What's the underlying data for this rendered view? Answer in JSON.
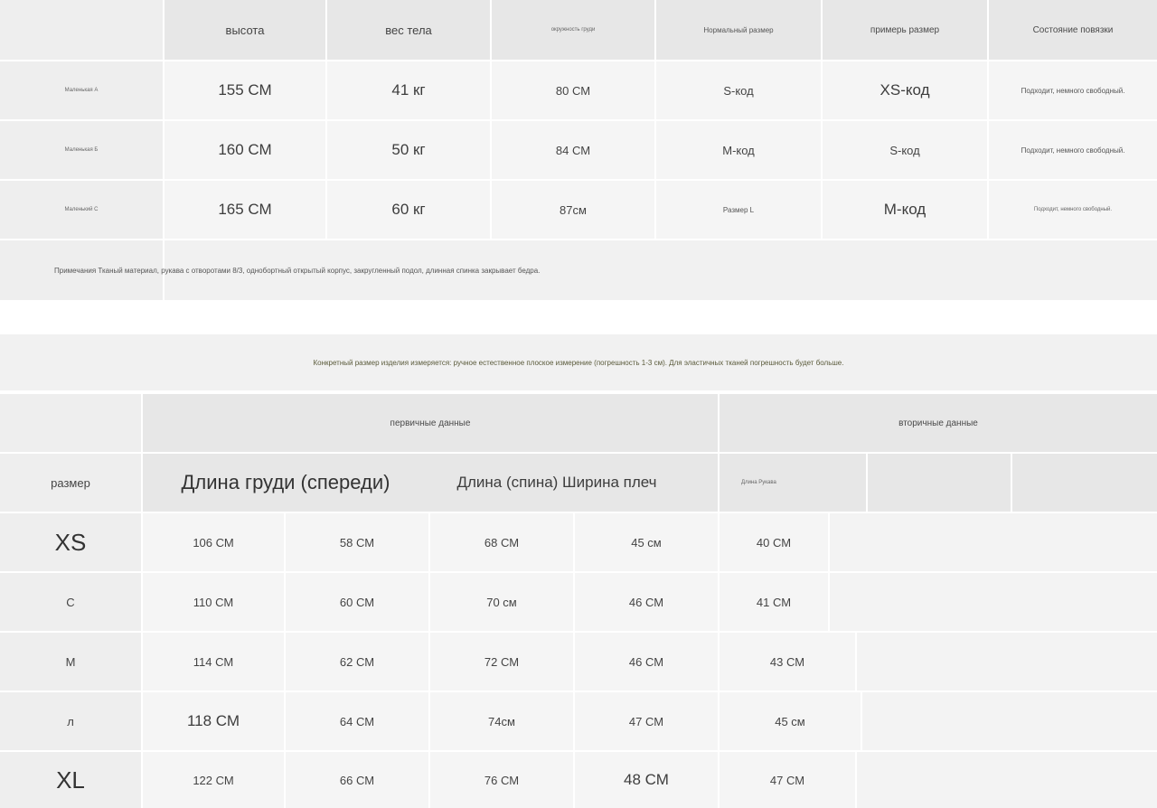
{
  "top_table": {
    "headers": [
      "высота",
      "вес тела",
      "окружность груди",
      "Нормальный размер",
      "примерь размер",
      "Состояние повязки"
    ],
    "rows": [
      {
        "label": "Маленькая А",
        "height": "155 СМ",
        "weight": "41 кг",
        "chest": "80 СМ",
        "normal": "S-код",
        "tried": "XS-код",
        "fit": "Подходит, немного свободный."
      },
      {
        "label": "Маленькая Б",
        "height": "160 СМ",
        "weight": "50 кг",
        "chest": "84 СМ",
        "normal": "М-код",
        "tried": "S-код",
        "fit": "Подходит, немного свободный."
      },
      {
        "label": "Маленький С",
        "height": "165 СМ",
        "weight": "60 кг",
        "chest": "87см",
        "normal": "Размер L",
        "tried": "М-код",
        "fit": "Подходит, немного свободный."
      }
    ],
    "note": "Примечания Тканый материал, рукава с отворотами 8/3, однобортный открытый корпус, закругленный подол, длинная спинка закрывает бедра."
  },
  "measure_note": "Конкретный размер изделия измеряется: ручное естественное плоское измерение (погрешность 1-3 см). Для эластичных тканей погрешность будет больше.",
  "bottom_table": {
    "group_primary": "первичные данные",
    "group_secondary": "вторичные данные",
    "size_label": "размер",
    "col_headers": {
      "chest_front": "Длина груди (спереди)",
      "length_back_shoulder": "Длина (спина) Ширина плеч",
      "sleeve": "Длина Рукава"
    },
    "rows": [
      {
        "size": "XS",
        "chest": "106 СМ",
        "v2": "58 СМ",
        "v3": "68 СМ",
        "v4": "45 см",
        "v5": "40 СМ"
      },
      {
        "size": "С",
        "chest": "110 СМ",
        "v2": "60 СМ",
        "v3": "70 см",
        "v4": "46 СМ",
        "v5": "41 СМ"
      },
      {
        "size": "М",
        "chest": "114 СМ",
        "v2": "62 СМ",
        "v3": "72 СМ",
        "v4": "46 СМ",
        "v5": "43 СМ"
      },
      {
        "size": "л",
        "chest": "118 СМ",
        "v2": "64 СМ",
        "v3": "74см",
        "v4": "47 СМ",
        "v5": "45 см"
      },
      {
        "size": "XL",
        "chest": "122 СМ",
        "v2": "66 СМ",
        "v3": "76 СМ",
        "v4": "48 СМ",
        "v5": "47 СМ"
      }
    ]
  }
}
